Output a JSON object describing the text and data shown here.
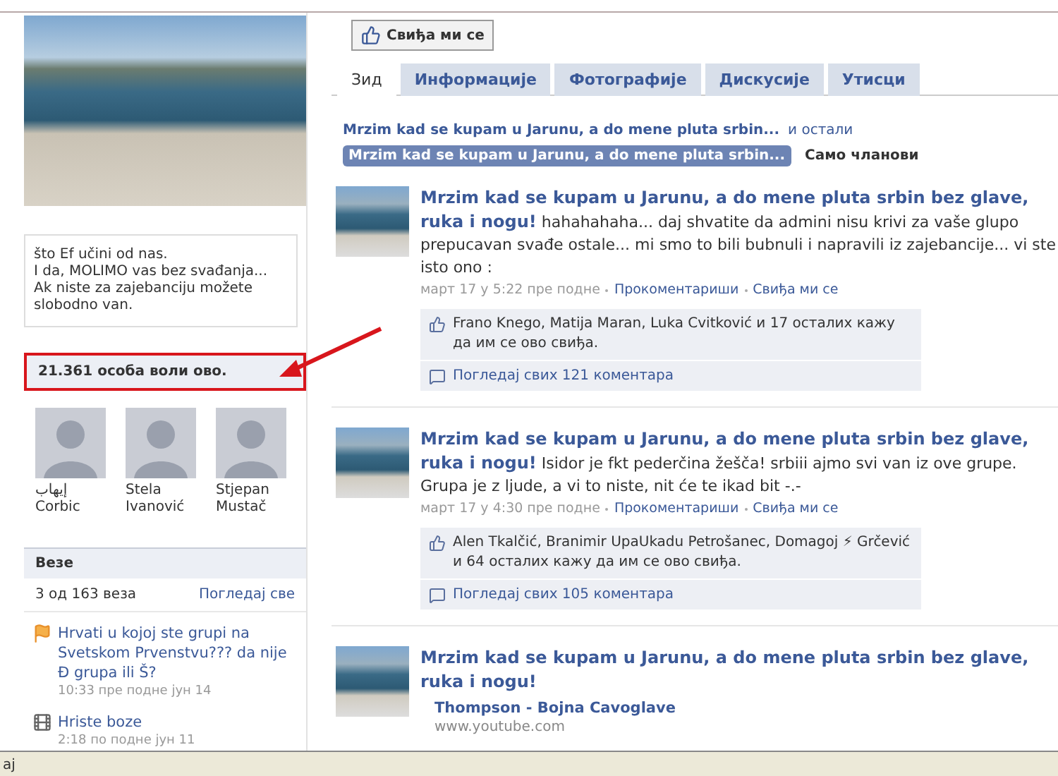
{
  "like_page_button": {
    "label": "Свиђа ми се"
  },
  "tabs": [
    {
      "label": "Зид",
      "selected": true
    },
    {
      "label": "Информације",
      "selected": false
    },
    {
      "label": "Фотографије",
      "selected": false
    },
    {
      "label": "Дискусије",
      "selected": false
    },
    {
      "label": "Утисци",
      "selected": false
    }
  ],
  "filter": {
    "group_link": "Mrzim kad se kupam u Jarunu, a do mene pluta srbin...",
    "others": "и остали",
    "options": [
      {
        "label": "Mrzim kad se kupam u Jarunu, a do mene pluta srbin...",
        "selected": true
      },
      {
        "label": "Само чланови",
        "selected": false
      }
    ]
  },
  "sidebar": {
    "description": "što Ef učini od nas.\nI da, MOLIMO vas bez svađanja...\nAk niste za zajebanciju možete slobodno van.",
    "likes": {
      "count_text": "21.361 особа воли ово.",
      "highlighted": true
    },
    "fans": [
      {
        "name": "إيهاب Corbic"
      },
      {
        "name": "Stela Ivanović"
      },
      {
        "name": "Stjepan Mustač"
      }
    ],
    "links": {
      "title": "Везе",
      "count": "3 од 163 веза",
      "see_all": "Погледај све",
      "items": [
        {
          "kind": "note",
          "title": "Hrvati u kojoj ste grupi na Svetskom Prvenstvu??? da nije Đ grupa ili Š?",
          "time": "10:33 пре подне јун 14"
        },
        {
          "kind": "video",
          "title": "Hriste boze",
          "time": "2:18 по подне јун 11"
        }
      ]
    }
  },
  "posts": [
    {
      "author": "Mrzim kad se kupam u Jarunu, a do mene pluta srbin bez glave, ruka i nogu!",
      "text": "hahahahaha... daj shvatite da admini nisu krivi za vaše glupo prepucavan svađe ostale... mi smo to bili bubnuli i napravili iz zajebancije... vi ste isto ono :",
      "time": "март 17 у 5:22 пре подне",
      "comment": "Прокоментариши",
      "like": "Свиђа ми се",
      "likes_text": "Frano Knego, Matija Maran, Luka Cvitković и 17 осталих кажу да им се ово свиђа.",
      "view_comments": "Погледај свих 121 коментара"
    },
    {
      "author": "Mrzim kad se kupam u Jarunu, a do mene pluta srbin bez glave, ruka i nogu!",
      "text": "Isidor je fkt pederčina žešča! srbiii ajmo svi van iz ove grupe. Grupa je z ljude, a vi to niste, nit će te ikad bit -.-",
      "time": "март 17 у 4:30 пре подне",
      "comment": "Прокоментариши",
      "like": "Свиђа ми се",
      "likes_text": "Alen Tkalčić, Branimir UpaUkadu Petrošanec, Domagoj ⚡ Grčević и 64 осталих кажу да им се ово свиђа.",
      "view_comments": "Погледај свих 105 коментара"
    },
    {
      "author": "Mrzim kad se kupam u Jarunu, a do mene pluta srbin bez glave, ruka i nogu!",
      "attachment": {
        "title": "Thompson - Bojna Cavoglave",
        "source": "www.youtube.com"
      }
    }
  ],
  "status_bar": {
    "text": "aj"
  }
}
